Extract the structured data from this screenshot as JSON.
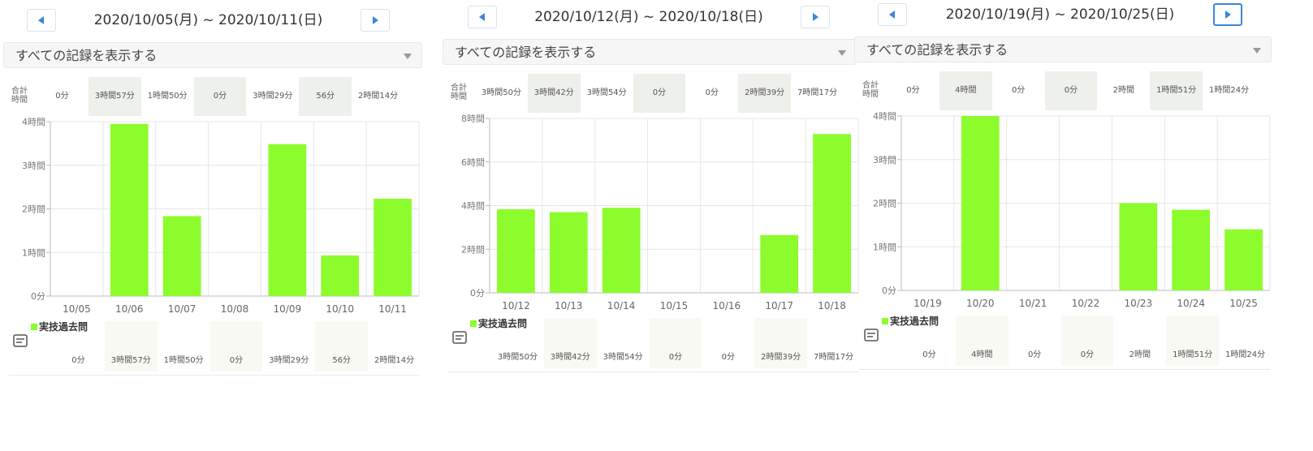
{
  "colors": {
    "bar": "#8cfc2c",
    "accent": "#3a86d9",
    "grid": "#e6e6e6"
  },
  "icons": {
    "prev": "triangle-left-icon",
    "next": "triangle-right-icon",
    "legend": "pencil-notebook-icon"
  },
  "labels": {
    "filter": "すべての記録を表示する",
    "total": [
      "合計",
      "時間"
    ],
    "legend": "実技過去問"
  },
  "panels": [
    {
      "range": "2020/10/05(月) ~ 2020/10/11(日)",
      "totals": [
        "0分",
        "3時間57分",
        "1時間50分",
        "0分",
        "3時間29分",
        "56分",
        "2時間14分"
      ]
    },
    {
      "range": "2020/10/12(月) ~ 2020/10/18(日)",
      "totals": [
        "3時間50分",
        "3時間42分",
        "3時間54分",
        "0分",
        "0分",
        "2時間39分",
        "7時間17分"
      ]
    },
    {
      "range": "2020/10/19(月) ~ 2020/10/25(日)",
      "totals": [
        "0分",
        "4時間",
        "0分",
        "0分",
        "2時間",
        "1時間51分",
        "1時間24分"
      ]
    }
  ],
  "chart_data": [
    {
      "type": "bar",
      "series": [
        {
          "name": "実技過去問",
          "values": [
            0,
            3.95,
            1.833,
            0,
            3.483,
            0.933,
            2.233
          ]
        }
      ],
      "categories": [
        "10/05",
        "10/06",
        "10/07",
        "10/08",
        "10/09",
        "10/10",
        "10/11"
      ],
      "ylim": [
        0,
        4
      ],
      "yticks": [
        0,
        1,
        2,
        3,
        4
      ],
      "yticklabels": [
        "0分",
        "1時間",
        "2時間",
        "3時間",
        "4時間"
      ],
      "grid": true
    },
    {
      "type": "bar",
      "series": [
        {
          "name": "実技過去問",
          "values": [
            3.833,
            3.7,
            3.9,
            0,
            0,
            2.65,
            7.283
          ]
        }
      ],
      "categories": [
        "10/12",
        "10/13",
        "10/14",
        "10/15",
        "10/16",
        "10/17",
        "10/18"
      ],
      "ylim": [
        0,
        8
      ],
      "yticks": [
        0,
        2,
        4,
        6,
        8
      ],
      "yticklabels": [
        "0分",
        "2時間",
        "4時間",
        "6時間",
        "8時間"
      ],
      "grid": true
    },
    {
      "type": "bar",
      "series": [
        {
          "name": "実技過去問",
          "values": [
            0,
            4,
            0,
            0,
            2,
            1.85,
            1.4
          ]
        }
      ],
      "categories": [
        "10/19",
        "10/20",
        "10/21",
        "10/22",
        "10/23",
        "10/24",
        "10/25"
      ],
      "ylim": [
        0,
        4
      ],
      "yticks": [
        0,
        1,
        2,
        3,
        4
      ],
      "yticklabels": [
        "0分",
        "1時間",
        "2時間",
        "3時間",
        "4時間"
      ],
      "grid": true
    }
  ]
}
